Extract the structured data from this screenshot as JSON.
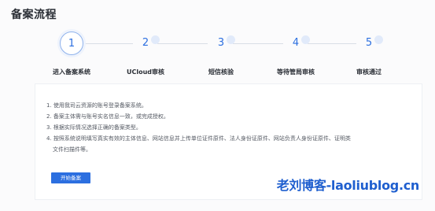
{
  "page": {
    "title": "备案流程"
  },
  "steps": [
    {
      "num": "1",
      "label": "进入备案系统",
      "active": true
    },
    {
      "num": "2",
      "label": "UCloud审核",
      "active": false
    },
    {
      "num": "3",
      "label": "短信核验",
      "active": false
    },
    {
      "num": "4",
      "label": "等待管局审核",
      "active": false
    },
    {
      "num": "5",
      "label": "审核通过",
      "active": false
    }
  ],
  "instructions": [
    "1. 使用我司云资源的账号登录备案系统。",
    "2. 备案主体需与账号实名信息一致，或完成授权。",
    "3. 根据实际情况选择正确的备案类型。",
    "4. 按照系统说明填写真实有效的主体信息、网站信息并上传单位证件原件、法人身份证原件、网站负责人身份证原件、证明类",
    "    文件扫描件等。"
  ],
  "start_button": {
    "label": "开始备案"
  },
  "watermark": {
    "text": "老刘博客-laoliublog.cn"
  },
  "colors": {
    "accent": "#2c6fe0",
    "watermark": "#1f5fcf"
  }
}
